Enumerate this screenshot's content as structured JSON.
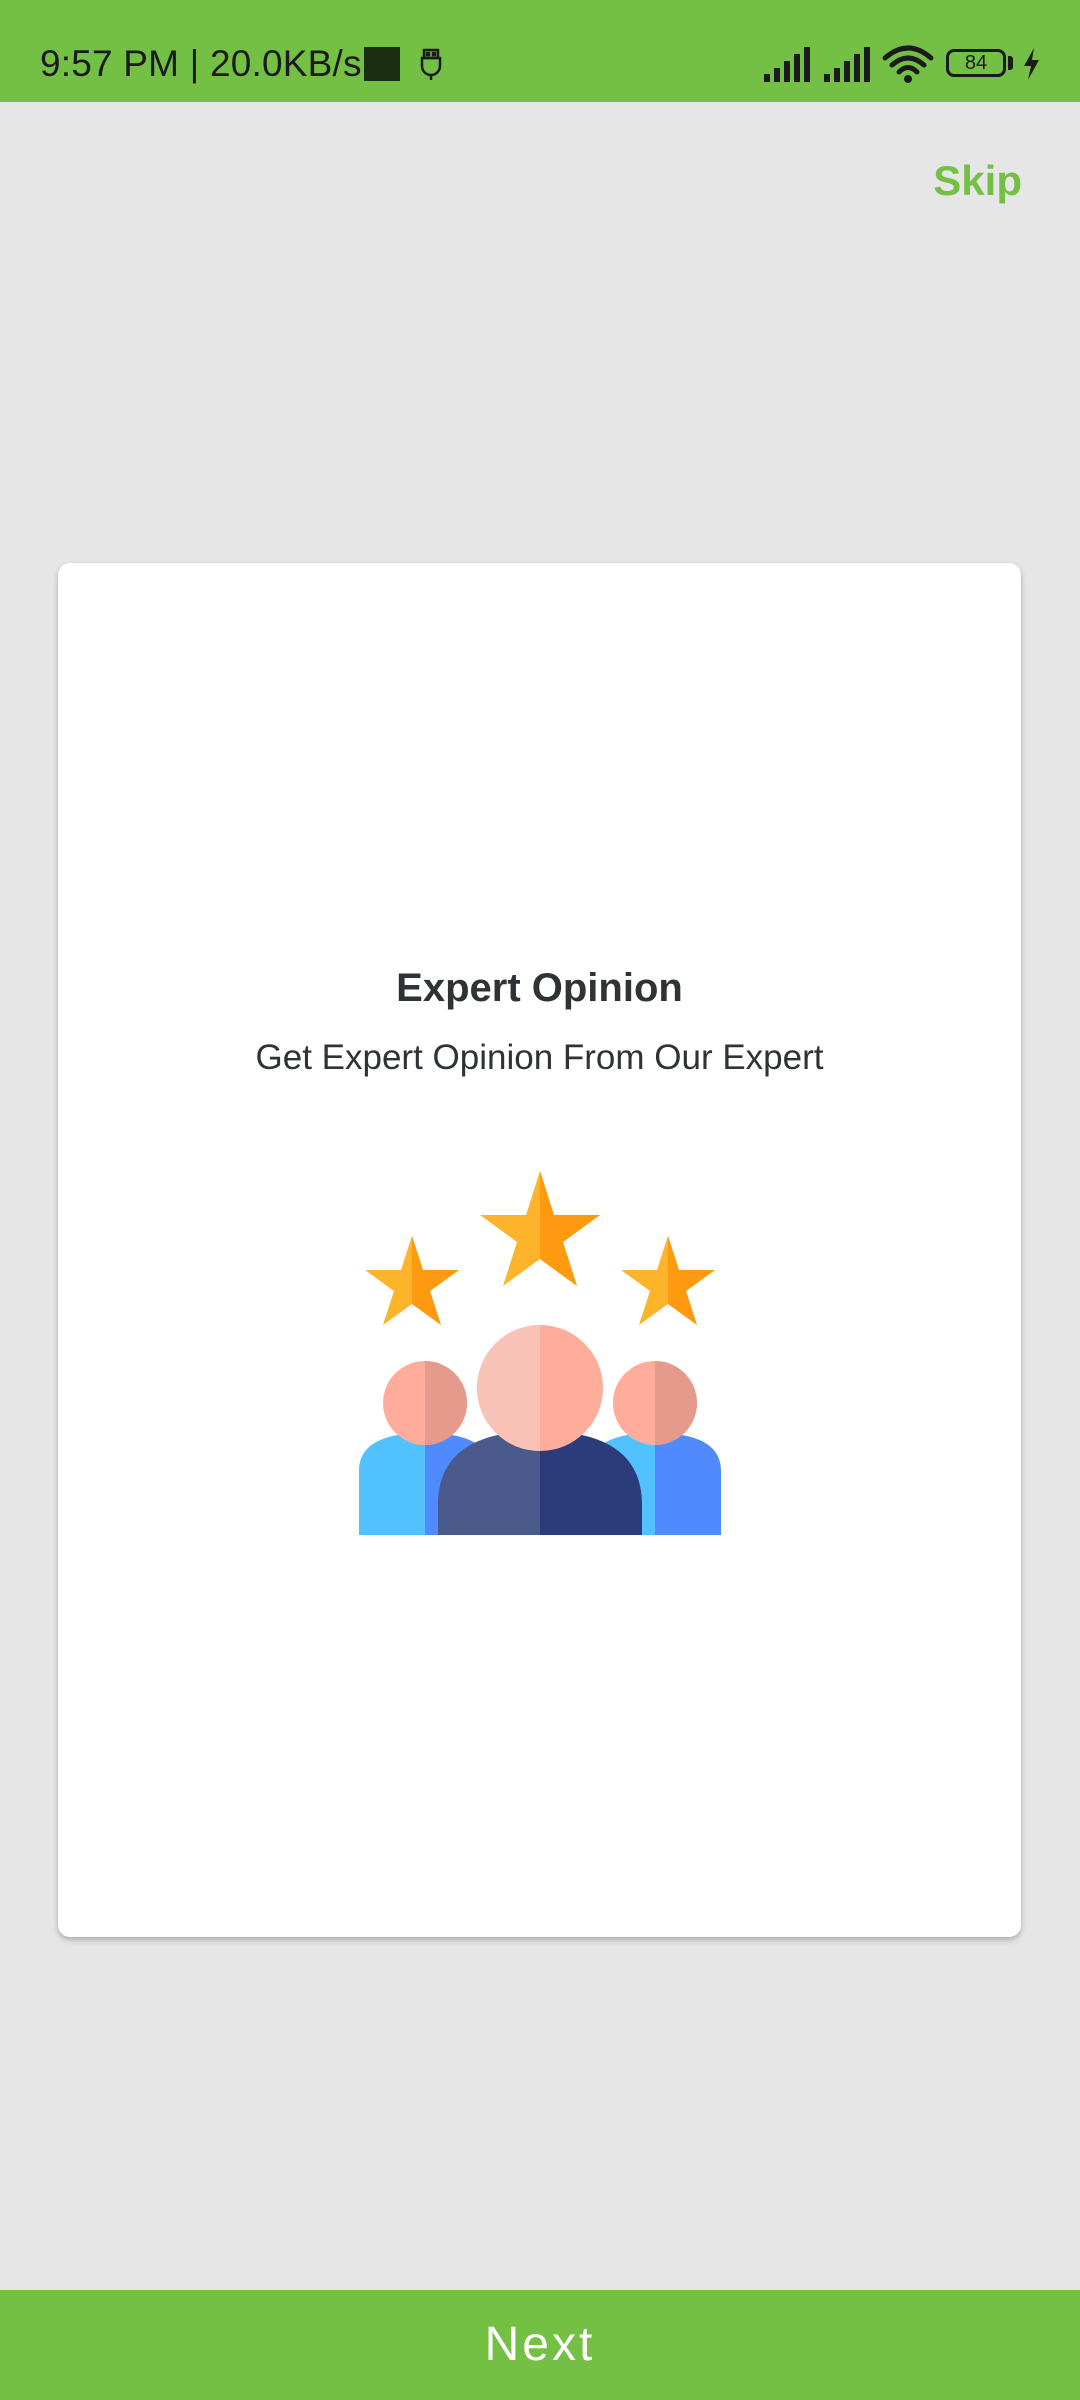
{
  "status_bar": {
    "time_speed": "9:57 PM | 20.0KB/s",
    "battery_level": "84",
    "background": "#74c045",
    "icons": [
      "stop-square-icon",
      "usb-icon",
      "signal-icon",
      "signal-icon",
      "wifi-icon",
      "battery-icon",
      "charging-icon"
    ]
  },
  "header": {
    "skip_label": "Skip"
  },
  "onboarding_card": {
    "title": "Expert Opinion",
    "subtitle": "Get Expert Opinion From Our Expert",
    "illustration": "expert-rating-group-icon"
  },
  "footer": {
    "next_label": "Next"
  },
  "colors": {
    "accent": "#74c045",
    "background": "#e6e6e6",
    "card": "#ffffff",
    "text": "#2e3336"
  }
}
